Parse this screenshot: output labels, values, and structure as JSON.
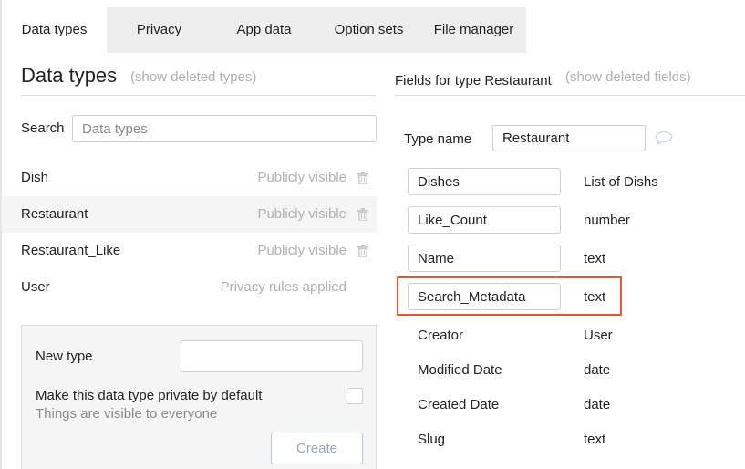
{
  "tabs": [
    {
      "label": "Data types",
      "active": true
    },
    {
      "label": "Privacy",
      "active": false
    },
    {
      "label": "App data",
      "active": false
    },
    {
      "label": "Option sets",
      "active": false
    },
    {
      "label": "File manager",
      "active": false
    }
  ],
  "left_panel": {
    "title": "Data types",
    "show_deleted": "(show deleted types)",
    "search_label": "Search",
    "search_placeholder": "Data types",
    "types": [
      {
        "name": "Dish",
        "status": "Publicly visible",
        "selected": false,
        "icon": "trash-icon"
      },
      {
        "name": "Restaurant",
        "status": "Publicly visible",
        "selected": true,
        "icon": "trash-icon"
      },
      {
        "name": "Restaurant_Like",
        "status": "Publicly visible",
        "selected": false,
        "icon": "trash-icon"
      },
      {
        "name": "User",
        "status": "Privacy rules applied",
        "selected": false,
        "icon": null
      }
    ],
    "new_type": {
      "label": "New type",
      "private_label": "Make this data type private by default",
      "hint": "Things are visible to everyone",
      "create_label": "Create"
    }
  },
  "right_panel": {
    "title": "Fields for type Restaurant",
    "show_deleted": "(show deleted fields)",
    "type_name_label": "Type name",
    "type_name_value": "Restaurant",
    "editable_fields": [
      {
        "name": "Dishes",
        "type": "List of Dishs"
      },
      {
        "name": "Like_Count",
        "type": "number"
      },
      {
        "name": "Name",
        "type": "text"
      },
      {
        "name": "Search_Metadata",
        "type": "text"
      }
    ],
    "builtin_fields": [
      {
        "name": "Creator",
        "type": "User"
      },
      {
        "name": "Modified Date",
        "type": "date"
      },
      {
        "name": "Created Date",
        "type": "date"
      },
      {
        "name": "Slug",
        "type": "text"
      }
    ]
  },
  "colors": {
    "highlight": "#e5573b",
    "muted_text": "#b0b0b0",
    "tab_bg": "#eeeeee"
  }
}
